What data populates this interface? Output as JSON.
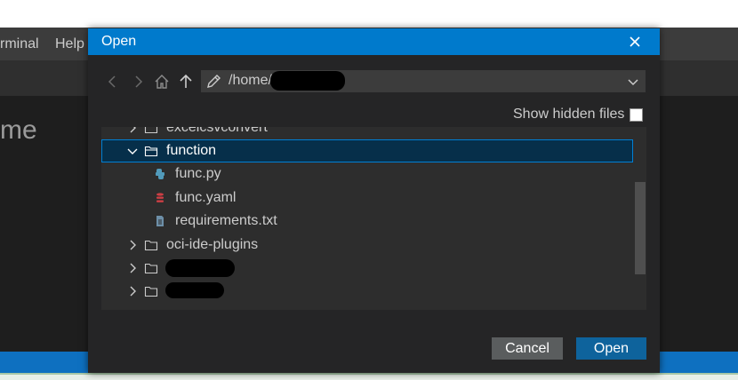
{
  "background": {
    "menu": [
      "rminal",
      "Help"
    ],
    "editor_title": "me"
  },
  "dialog": {
    "title": "Open",
    "path": "/home/",
    "show_hidden_label": "Show hidden files",
    "show_hidden_checked": false,
    "tree": [
      {
        "name": "excelcsvconvert",
        "type": "folder",
        "expanded": false
      },
      {
        "name": "function",
        "type": "folder",
        "expanded": true,
        "selected": true
      },
      {
        "name": "func.py",
        "type": "python-file"
      },
      {
        "name": "func.yaml",
        "type": "yaml-file"
      },
      {
        "name": "requirements.txt",
        "type": "text-file"
      },
      {
        "name": "oci-ide-plugins",
        "type": "folder",
        "expanded": false
      },
      {
        "name": "",
        "type": "folder",
        "expanded": false,
        "redacted": true
      },
      {
        "name": "",
        "type": "folder",
        "expanded": false,
        "redacted": true
      }
    ],
    "cancel_label": "Cancel",
    "open_label": "Open"
  },
  "colors": {
    "accent": "#007acc",
    "selection": "#062f4a",
    "python_icon": "#519aba",
    "yaml_icon": "#cc3e44"
  }
}
